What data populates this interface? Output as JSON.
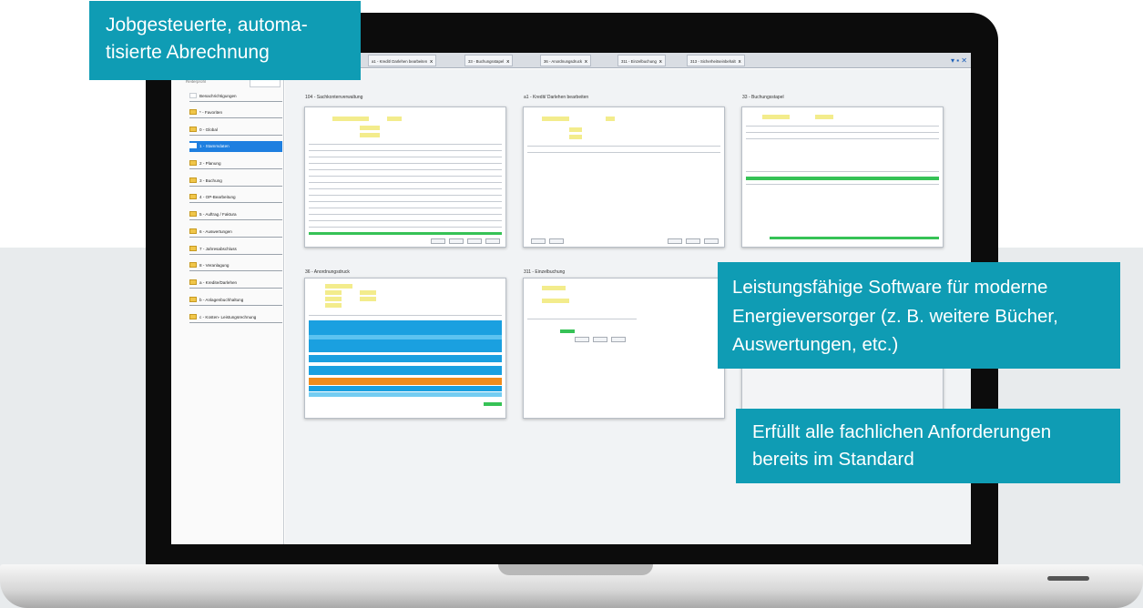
{
  "callouts": {
    "top_left": {
      "line1": "Jobgesteuerte, automa-",
      "line2": "tisierte Abrechnung"
    },
    "middle_right": {
      "line1": "Leistungsfähige Software für moderne",
      "line2": "Energieversorger (z. B. weitere Bücher,",
      "line3": "Auswertungen, etc.)"
    },
    "bottom_right": {
      "line1": "Erfüllt alle fachlichen Anforderungen",
      "line2": "bereits im Standard"
    }
  },
  "app": {
    "tabs": [
      {
        "label": "a1 - Kredit/ Darlehen bearbeiten",
        "close": "X"
      },
      {
        "label": "33 - Buchungsstapel",
        "close": "X"
      },
      {
        "label": "36 - Anordnungsdruck",
        "close": "X"
      },
      {
        "label": "311 - Einzelbuchung",
        "close": "X"
      },
      {
        "label": "313 - Sicherheitseinbehalt",
        "close": "X"
      }
    ],
    "sidebar": {
      "search_label": "Reiterprofil",
      "items": [
        {
          "label": "Benachrichtigungen",
          "folder": "white",
          "active": false
        },
        {
          "label": "* - Favoriten",
          "folder": "yellow",
          "active": false
        },
        {
          "label": "0 - Global",
          "folder": "yellow",
          "active": false
        },
        {
          "label": "1 - Stammdaten",
          "folder": "yellow",
          "active": true
        },
        {
          "label": "2 - Planung",
          "folder": "yellow",
          "active": false
        },
        {
          "label": "3 - Buchung",
          "folder": "yellow",
          "active": false
        },
        {
          "label": "4 - OP-Bearbeitung",
          "folder": "yellow",
          "active": false
        },
        {
          "label": "5 - Auftrag / Faktura",
          "folder": "yellow",
          "active": false
        },
        {
          "label": "6 - Auswertungen",
          "folder": "yellow",
          "active": false
        },
        {
          "label": "7 - Jahresabschluss",
          "folder": "yellow",
          "active": false
        },
        {
          "label": "8 - Veranlagung",
          "folder": "yellow",
          "active": false
        },
        {
          "label": "a - Kredite/Darlehen",
          "folder": "yellow",
          "active": false
        },
        {
          "label": "b - Anlagenbuchhaltung",
          "folder": "yellow",
          "active": false
        },
        {
          "label": "c - Kosten- Leistungsrechnung",
          "folder": "yellow",
          "active": false
        }
      ]
    },
    "windows": [
      {
        "title": "104 - Sachkontenverwaltung"
      },
      {
        "title": "a1 - Kredit/ Darlehen bearbeiten"
      },
      {
        "title": "33 - Buchungsstapel"
      },
      {
        "title": "36 - Anordnungsdruck"
      },
      {
        "title": "311 - Einzelbuchung"
      }
    ],
    "colors": {
      "callout": "#0f9cb4",
      "active_item": "#1e7fe0",
      "row_blue": "#1aa0e0",
      "row_orange": "#f08c1c",
      "row_green": "#36c256"
    }
  }
}
